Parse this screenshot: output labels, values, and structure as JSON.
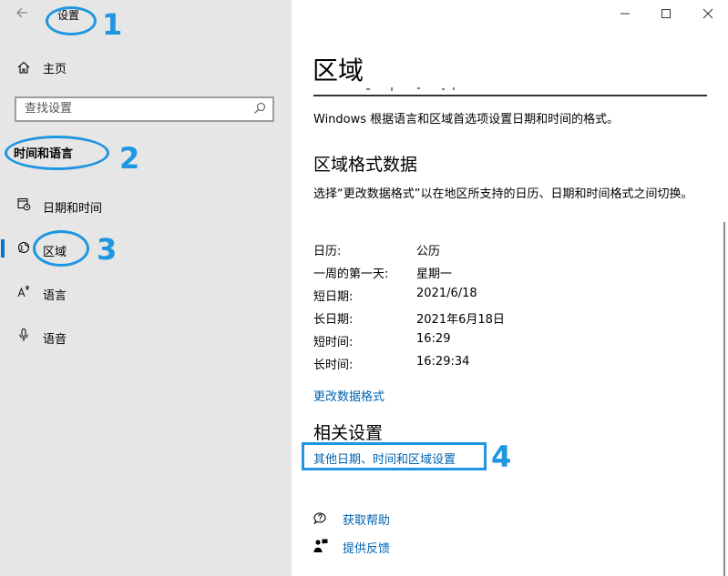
{
  "window": {
    "app_title": "设置",
    "controls": {
      "minimize": "—",
      "maximize": "☐",
      "close": "✕"
    }
  },
  "sidebar": {
    "home_label": "主页",
    "search_placeholder": "查找设置",
    "section_title": "时间和语言",
    "items": [
      {
        "label": "日期和时间",
        "icon": "calendar-clock-icon"
      },
      {
        "label": "区域",
        "icon": "globe-icon",
        "selected": true
      },
      {
        "label": "语言",
        "icon": "language-icon"
      },
      {
        "label": "语音",
        "icon": "microphone-icon"
      }
    ]
  },
  "main": {
    "title": "区域",
    "description": "Windows 根据语言和区域首选项设置日期和时间的格式。",
    "regional_format_heading": "区域格式数据",
    "regional_format_desc": "选择“更改数据格式”以在地区所支持的日历、日期和时间格式之间切换。",
    "format_rows": [
      {
        "key": "日历:",
        "value": "公历"
      },
      {
        "key": "一周的第一天:",
        "value": "星期一"
      },
      {
        "key": "短日期:",
        "value": "2021/6/18"
      },
      {
        "key": "长日期:",
        "value": "2021年6月18日"
      },
      {
        "key": "短时间:",
        "value": "16:29"
      },
      {
        "key": "长时间:",
        "value": "16:29:34"
      }
    ],
    "change_format_link": "更改数据格式",
    "related_heading": "相关设置",
    "related_link": "其他日期、时间和区域设置",
    "help_link": "获取帮助",
    "feedback_link": "提供反馈"
  },
  "annotations": [
    "1",
    "2",
    "3",
    "4"
  ],
  "colors": {
    "accent": "#0078d7",
    "link": "#0063b1",
    "annotation": "#1e96e0",
    "sidebar_bg": "#e6e6e6"
  }
}
